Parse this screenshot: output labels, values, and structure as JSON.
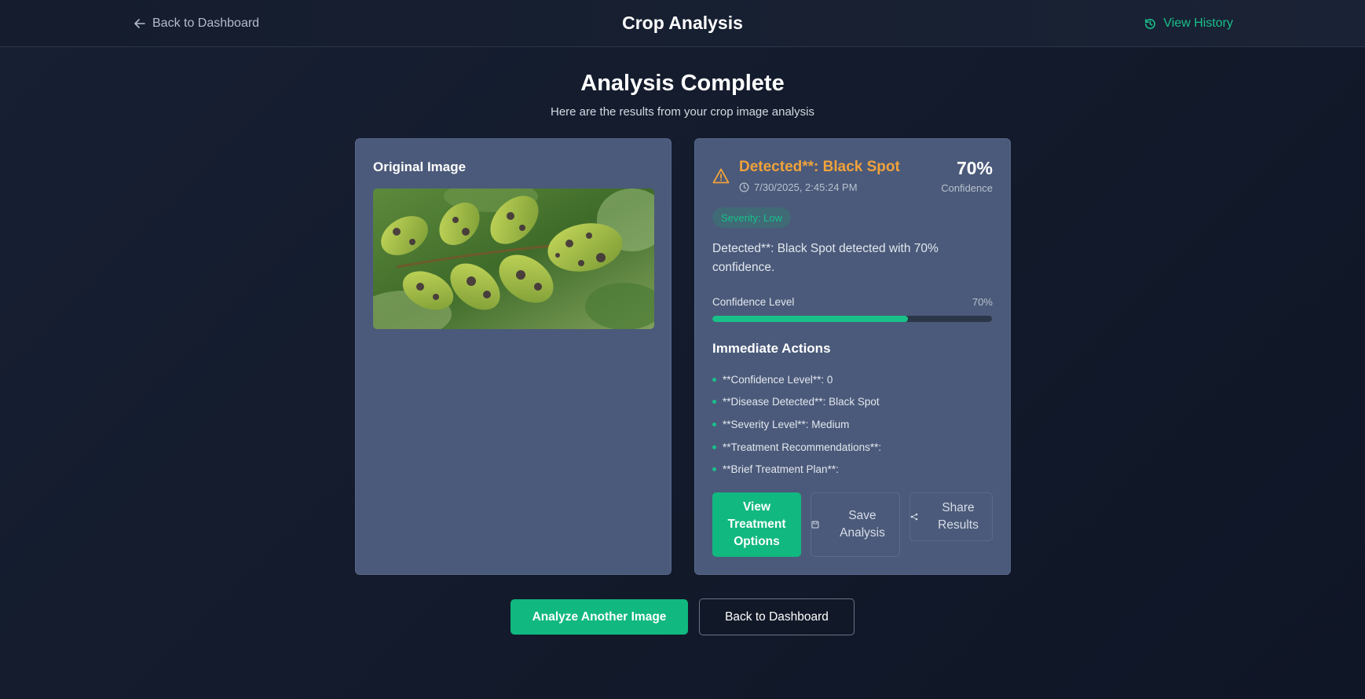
{
  "header": {
    "back_label": "Back to Dashboard",
    "title": "Crop Analysis",
    "history_label": "View History"
  },
  "hero": {
    "title": "Analysis Complete",
    "subtitle": "Here are the results from your crop image analysis"
  },
  "original": {
    "label": "Original Image"
  },
  "result": {
    "title": "Detected**: Black Spot",
    "timestamp": "7/30/2025, 2:45:24 PM",
    "confidence": "70%",
    "confidence_caption": "Confidence",
    "severity": "Severity: Low",
    "description": "Detected**: Black Spot detected with 70% confidence.",
    "confidence_level_label": "Confidence Level",
    "confidence_level_value": "70%",
    "confidence_fraction": 0.7,
    "actions_title": "Immediate Actions",
    "actions": [
      "**Confidence Level**: 0",
      "**Disease Detected**: Black Spot",
      "**Severity Level**: Medium",
      "**Treatment Recommendations**:",
      "**Brief Treatment Plan**:"
    ],
    "buttons": {
      "treatment": "View Treatment Options",
      "save": "Save Analysis",
      "share": "Share Results"
    }
  },
  "footer": {
    "analyze_label": "Analyze Another Image",
    "back_label": "Back to Dashboard"
  },
  "colors": {
    "accent": "#11b87f",
    "warning": "#f0a23a",
    "card": "#4b5a7a"
  },
  "icons": {
    "back": "arrow-left-icon",
    "history": "history-icon",
    "warning": "warning-triangle-icon",
    "clock": "clock-icon",
    "save": "save-icon",
    "share": "share-icon"
  }
}
